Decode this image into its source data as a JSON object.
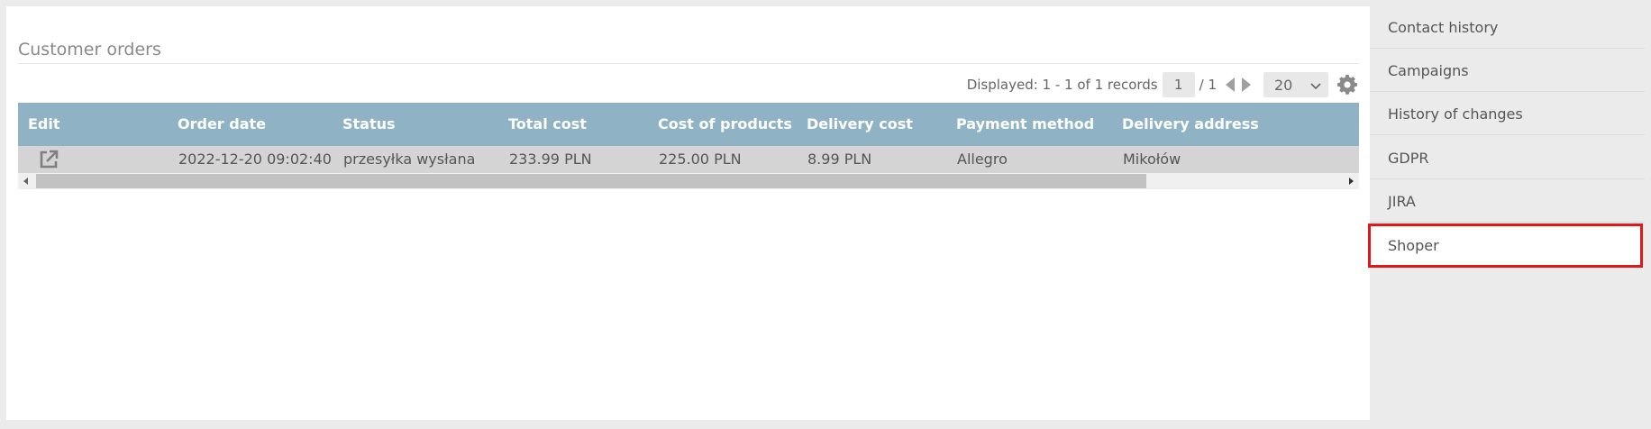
{
  "main": {
    "section_title": "Customer orders",
    "pager": {
      "displayed_text": "Displayed: 1 - 1 of 1 records",
      "current_page": "1",
      "total_pages": "/ 1",
      "per_page": "20"
    },
    "table": {
      "columns": [
        "Edit",
        "Order date",
        "Status",
        "Total cost",
        "Cost of products",
        "Delivery cost",
        "Payment method",
        "Delivery address"
      ],
      "rows": [
        {
          "order_date": "2022-12-20 09:02:40",
          "status": "przesyłka wysłana",
          "total_cost": "233.99 PLN",
          "cost_of_products": "225.00 PLN",
          "delivery_cost": "8.99 PLN",
          "payment_method": "Allegro",
          "delivery_address": "Mikołów"
        }
      ]
    }
  },
  "sidebar": {
    "items": [
      {
        "label": "Contact history"
      },
      {
        "label": "Campaigns"
      },
      {
        "label": "History of changes"
      },
      {
        "label": "GDPR"
      },
      {
        "label": "JIRA"
      },
      {
        "label": "Shoper"
      }
    ],
    "active_item": "Shoper"
  },
  "colors": {
    "table_header": "#8fb3c4",
    "row_bg": "#d4d4d4",
    "active_border": "#e01818",
    "page_bg": "#ebebeb"
  },
  "icons": {
    "edit": "external-link-icon",
    "prev": "triangle-left-icon",
    "next": "triangle-right-icon",
    "settings": "gear-icon",
    "dropdown": "chevron-down-icon"
  }
}
